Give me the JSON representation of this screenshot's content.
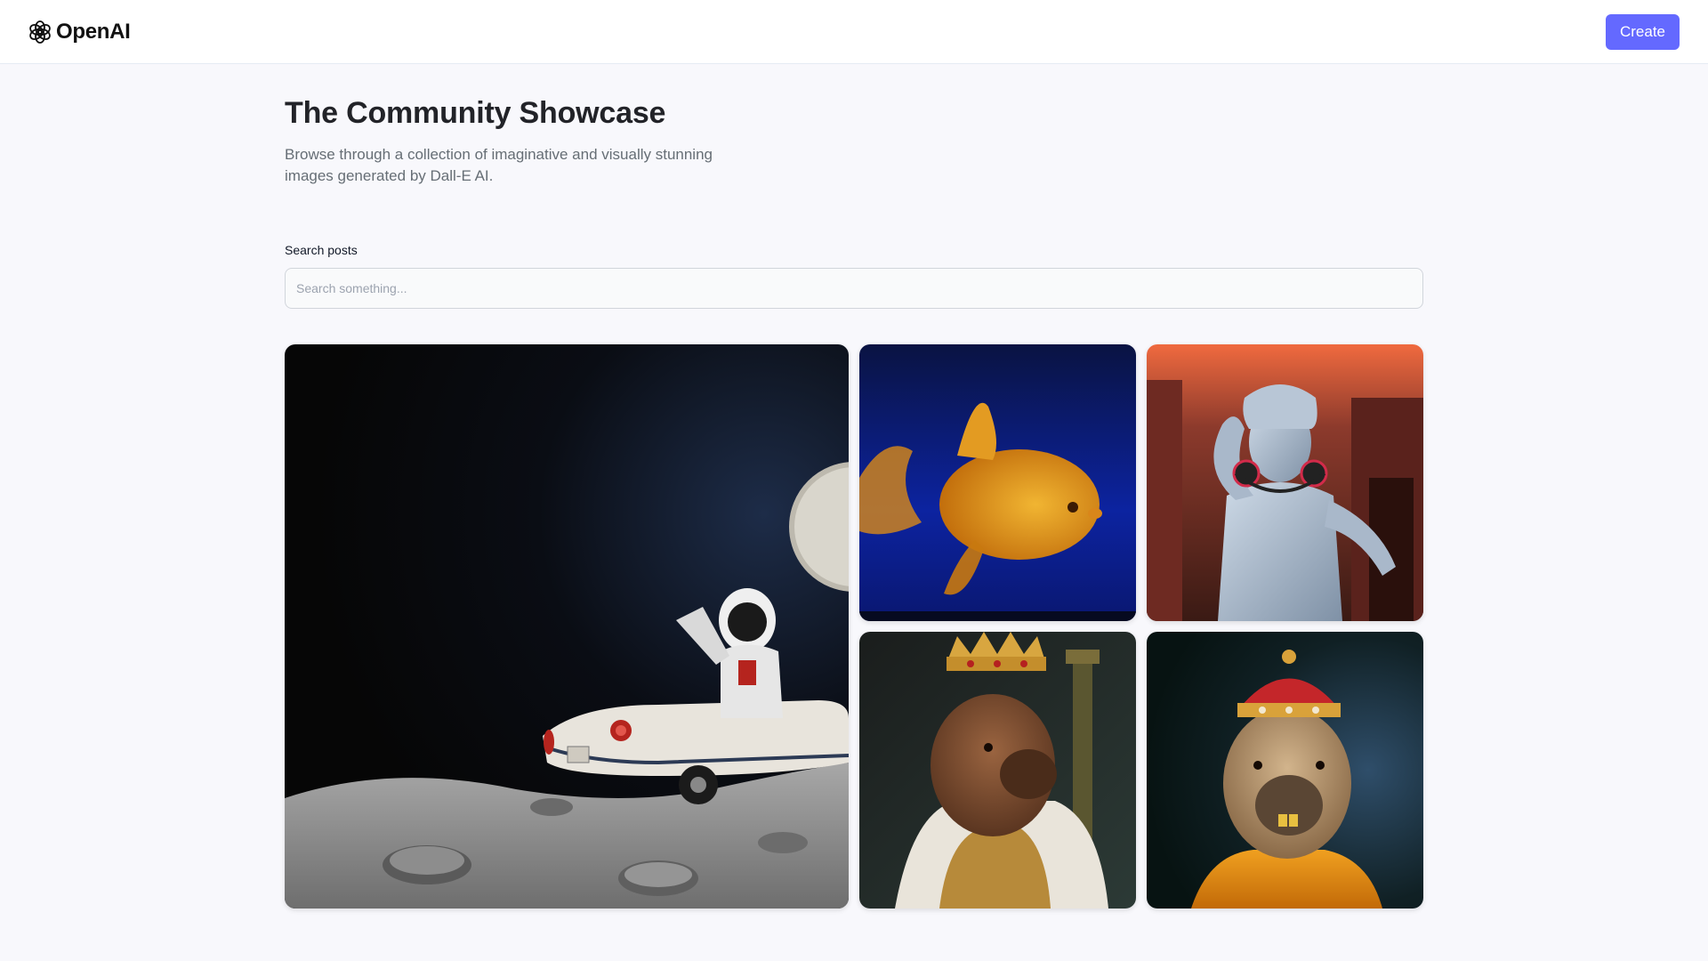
{
  "brand": {
    "name": "OpenAI",
    "logo_icon": "openai-logo-icon"
  },
  "header": {
    "create_label": "Create"
  },
  "showcase": {
    "title": "The Community Showcase",
    "subtitle": "Browse through a collection of imaginative and visually stunning images generated by Dall-E AI."
  },
  "search": {
    "label": "Search posts",
    "placeholder": "Search something...",
    "value": ""
  },
  "colors": {
    "accent": "#6469ff",
    "page_bg": "#f8f8fc",
    "title": "#222328",
    "subtitle": "#666e75"
  },
  "posts": [
    {
      "name": "astronaut-car-moon-image"
    },
    {
      "name": "goldfish-image"
    },
    {
      "name": "statue-headphones-image"
    },
    {
      "name": "capybara-king-image"
    },
    {
      "name": "capybara-crown-image"
    }
  ]
}
